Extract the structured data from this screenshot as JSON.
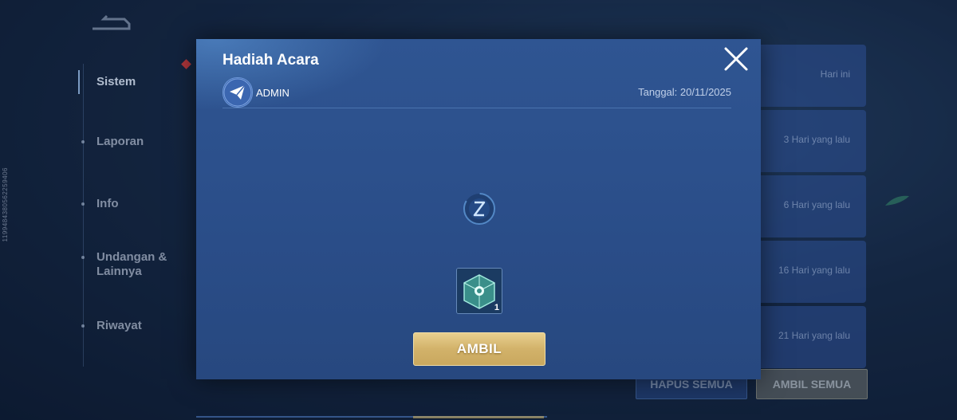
{
  "sidebar": {
    "items": [
      {
        "label": "Sistem"
      },
      {
        "label": "Laporan"
      },
      {
        "label": "Info"
      },
      {
        "label": "Undangan & Lainnya"
      },
      {
        "label": "Riwayat"
      }
    ]
  },
  "side_id": "1199484380562259406",
  "list": {
    "cards": [
      {
        "when": "Hari ini"
      },
      {
        "when": "3 Hari yang lalu"
      },
      {
        "when": "6 Hari yang lalu"
      },
      {
        "when": "16 Hari yang lalu"
      },
      {
        "when": "21 Hari yang lalu"
      }
    ],
    "delete_all_label": "HAPUS SEMUA",
    "claim_all_label": "AMBIL SEMUA"
  },
  "modal": {
    "title": "Hadiah Acara",
    "sender": "ADMIN",
    "date": "Tanggal: 20/11/2025",
    "reward": {
      "icon": "mystery-box-icon",
      "count": "1"
    },
    "claim_label": "AMBIL"
  },
  "colors": {
    "modal_bg": "#2c5190",
    "claim_gold": "#d2b26a",
    "badge_red": "#d23a3a"
  }
}
